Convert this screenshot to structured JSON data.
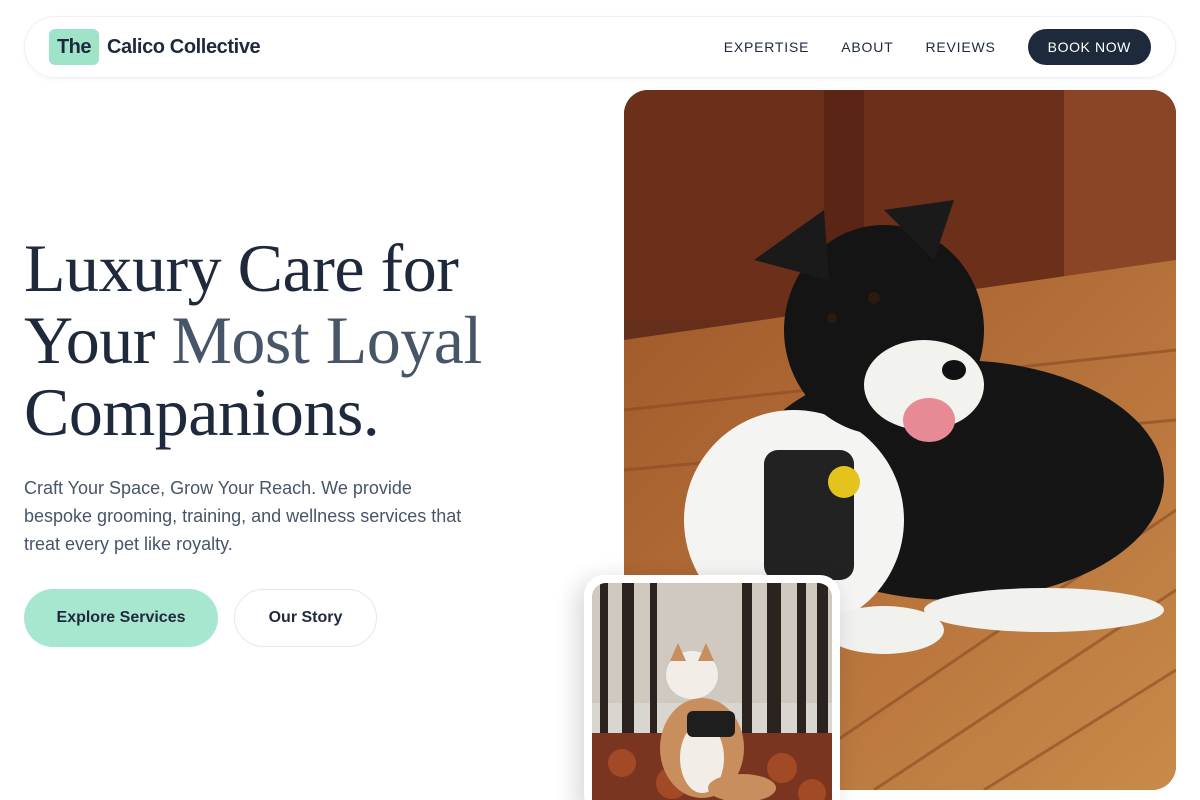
{
  "nav": {
    "logo_mark": "The",
    "brand_name": "Calico Collective",
    "links": [
      "EXPERTISE",
      "ABOUT",
      "REVIEWS"
    ],
    "cta": "BOOK NOW"
  },
  "hero": {
    "headline_line1": "Luxury Care for",
    "headline_line2_start": "Your ",
    "headline_line2_accent": "Most Loyal",
    "headline_line3": "Companions.",
    "subtext": "Craft Your Space, Grow Your Reach. We provide bespoke grooming, training, and wellness services that treat every pet like royalty.",
    "primary_button": "Explore Services",
    "secondary_button": "Our Story"
  },
  "images": {
    "main_photo": "dog-lying-on-wooden-deck-photo",
    "secondary_photo": "dog-sitting-in-autumn-forest-photo"
  },
  "colors": {
    "navy": "#1e293b",
    "slate": "#475569",
    "mint": "#a7e6cf"
  }
}
